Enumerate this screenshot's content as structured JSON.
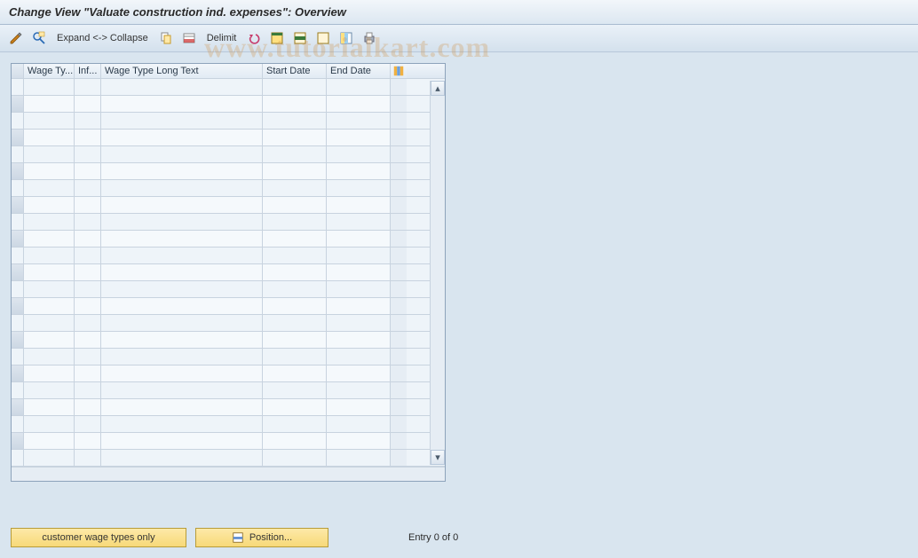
{
  "title": "Change View \"Valuate construction ind. expenses\": Overview",
  "toolbar": {
    "expand_label": "Expand <-> Collapse",
    "delimit_label": "Delimit"
  },
  "columns": {
    "wage_type": "Wage Ty...",
    "inf": "Inf...",
    "long_text": "Wage Type Long Text",
    "start_date": "Start Date",
    "end_date": "End Date"
  },
  "rows": 23,
  "footer": {
    "customer_btn": "customer wage types only",
    "position_btn": "Position...",
    "entry_text": "Entry 0 of 0"
  },
  "watermark": "www.tutorialkart.com"
}
